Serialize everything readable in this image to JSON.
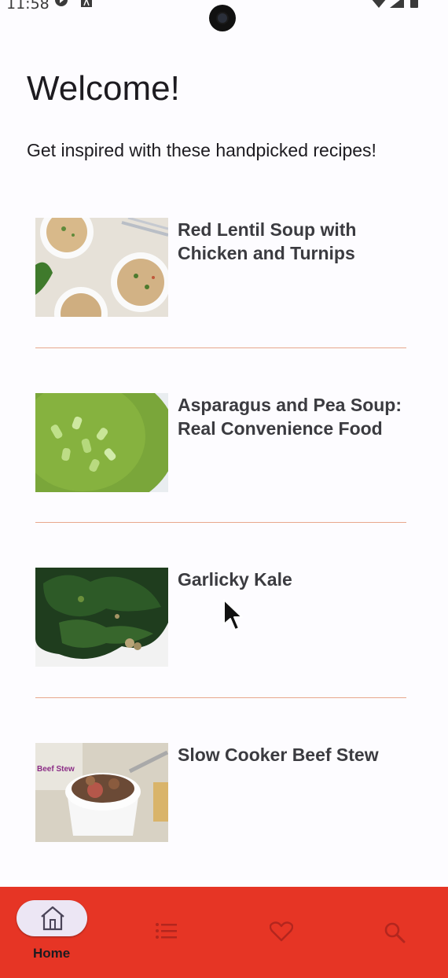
{
  "status_bar": {
    "time": "11:58"
  },
  "page": {
    "title": "Welcome!",
    "subtitle": "Get inspired with these handpicked recipes!"
  },
  "recipes": [
    {
      "title": "Red Lentil Soup with Chicken and Turnips",
      "image": "lentil-soup-photo"
    },
    {
      "title": "Asparagus and Pea Soup: Real Convenience Food",
      "image": "asparagus-soup-photo"
    },
    {
      "title": "Garlicky Kale",
      "image": "kale-photo"
    },
    {
      "title": "Slow Cooker Beef Stew",
      "image": "beef-stew-photo"
    }
  ],
  "bottom_nav": {
    "items": [
      {
        "label": "Home",
        "icon": "home-icon",
        "selected": true
      },
      {
        "label": "",
        "icon": "list-icon",
        "selected": false
      },
      {
        "label": "",
        "icon": "heart-icon",
        "selected": false
      },
      {
        "label": "",
        "icon": "search-icon",
        "selected": false
      }
    ]
  },
  "colors": {
    "nav_background": "#e63525",
    "divider": "#e8a78c",
    "selected_pill": "#ece6f4"
  }
}
